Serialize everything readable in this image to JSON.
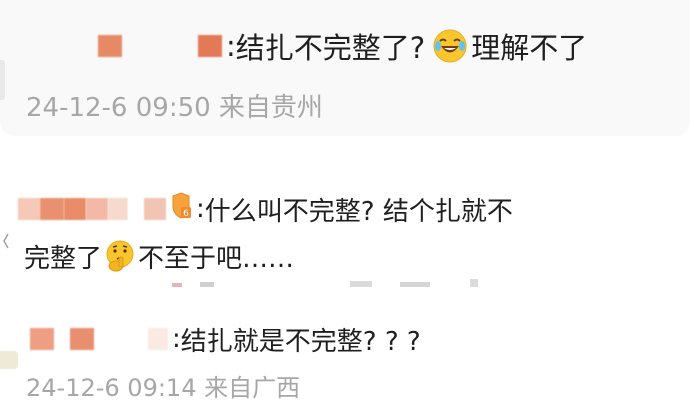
{
  "reply_top": {
    "separator": ":",
    "text": "结扎不完整了?",
    "emoji": "laughing-crying-emoji",
    "text_after": "理解不了",
    "timestamp": "24-12-6 09:50 来自贵州",
    "name_colors": [
      "#e58a64",
      "#e27a55"
    ]
  },
  "comment_2": {
    "separator": ":",
    "text_line1": "什么叫不完整? 结个扎就不",
    "text_line2_a": "完整了",
    "emoji": "thinking-emoji",
    "text_line2_b": "不至于吧……",
    "badge": "fan-level-badge",
    "badge_level": "6",
    "name_colors": [
      "#f6c8b8",
      "#e8906f",
      "#ea8c68",
      "#f3b9a6",
      "#f7d9ce",
      "#f1c4b3"
    ]
  },
  "comment_3": {
    "separator": ":",
    "text": "结扎就是不完整? ? ?",
    "timestamp": "24-12-6 09:14 来自广西",
    "name_colors": [
      "#ee9e82",
      "#e88f70",
      "#fbe9e3"
    ]
  },
  "colors": {
    "text": "#1f1f1f",
    "timestamp": "#a7a7a7",
    "card_bg": "#f9f9f9",
    "page_bg": "#ffffff"
  }
}
